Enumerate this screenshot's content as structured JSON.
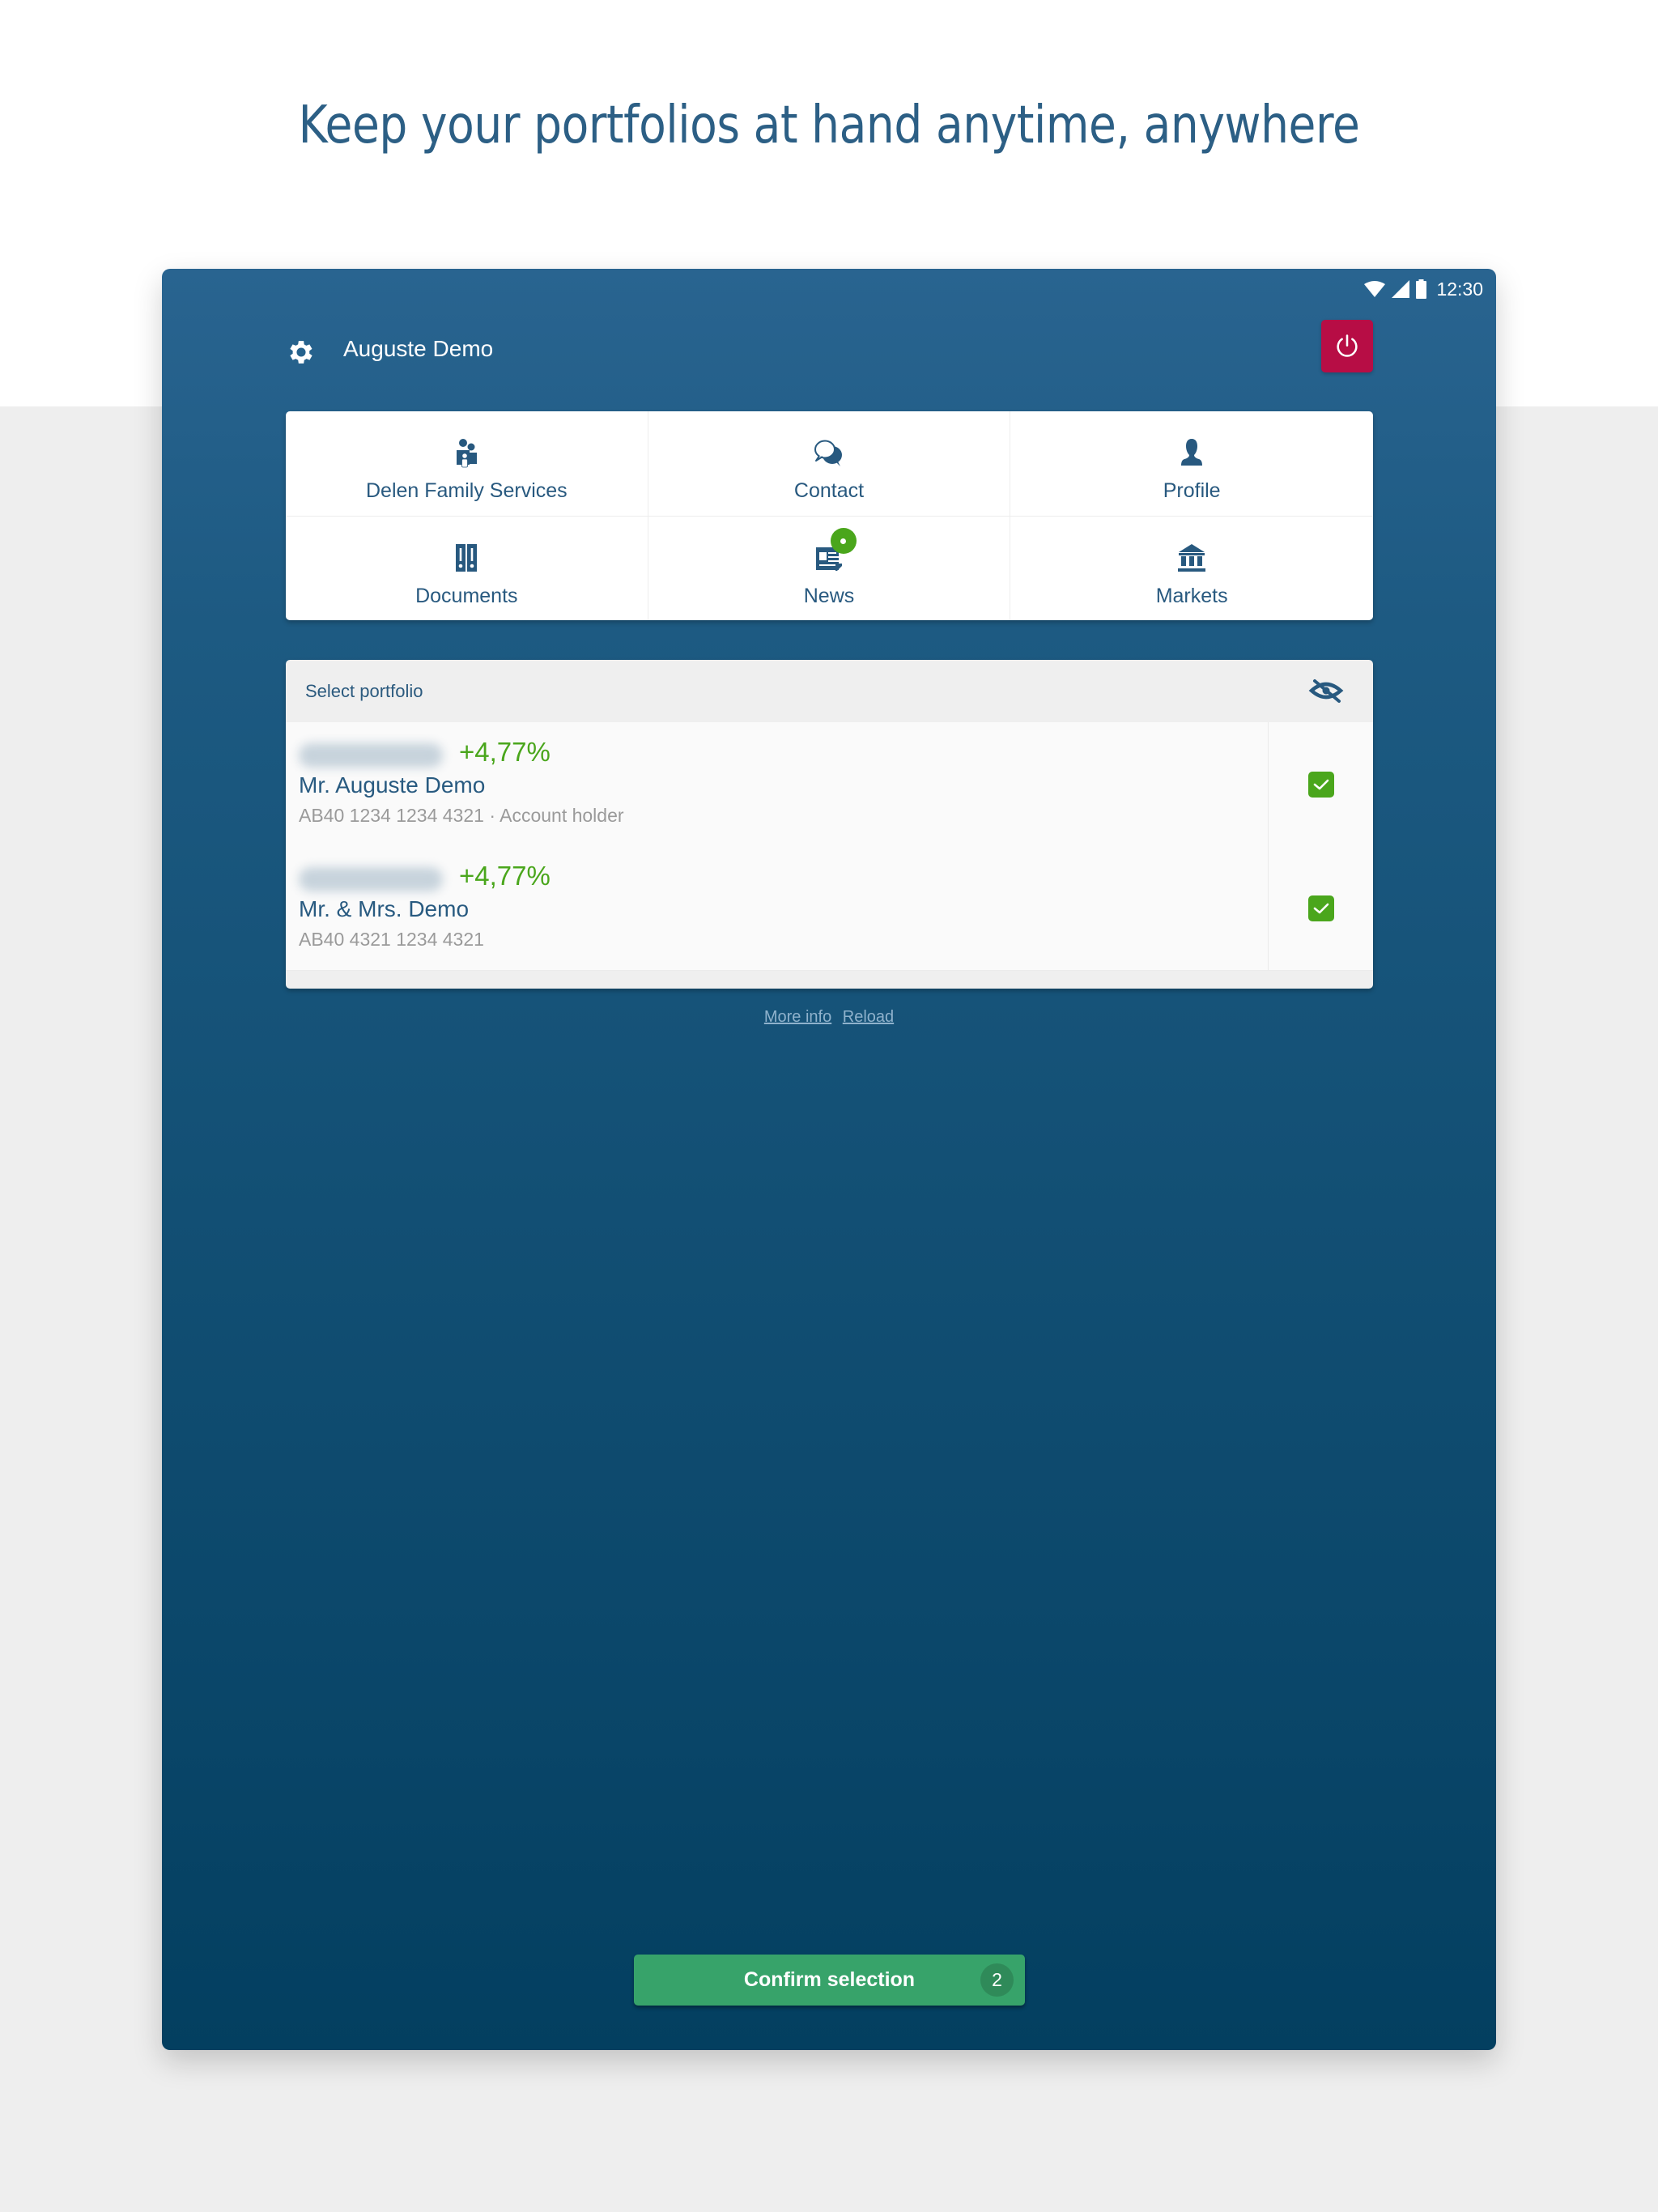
{
  "headline": "Keep your portfolios at hand anytime, anywhere",
  "status_bar": {
    "time": "12:30",
    "icons": [
      "wifi-icon",
      "cellular-signal-icon",
      "battery-icon"
    ]
  },
  "header": {
    "user_name": "Auguste Demo",
    "settings_icon": "gear-icon",
    "logout_icon": "power-icon"
  },
  "menu": {
    "items": [
      {
        "label": "Delen Family Services",
        "icon": "family-icon"
      },
      {
        "label": "Contact",
        "icon": "chat-bubbles-icon"
      },
      {
        "label": "Profile",
        "icon": "person-icon"
      },
      {
        "label": "Documents",
        "icon": "binders-icon"
      },
      {
        "label": "News",
        "icon": "newspaper-icon",
        "has_notification": true
      },
      {
        "label": "Markets",
        "icon": "bank-building-icon"
      }
    ]
  },
  "portfolio": {
    "title": "Select portfolio",
    "hide_amounts_icon": "eye-slash-icon",
    "rows": [
      {
        "amount": "hidden",
        "change": "+4,77%",
        "name": "Mr. Auguste Demo",
        "details": "AB40 1234 1234 4321 · Account holder",
        "checked": true
      },
      {
        "amount": "hidden",
        "change": "+4,77%",
        "name": "Mr. & Mrs. Demo",
        "details": "AB40 4321 1234 4321",
        "checked": true
      }
    ]
  },
  "links": {
    "more_info": "More info",
    "reload": "Reload"
  },
  "confirm": {
    "label": "Confirm selection",
    "count": "2"
  },
  "colors": {
    "brand_blue": "#28597f",
    "logout_red": "#b70d45",
    "positive_green": "#4aa61c",
    "confirm_green": "#37a36a"
  }
}
